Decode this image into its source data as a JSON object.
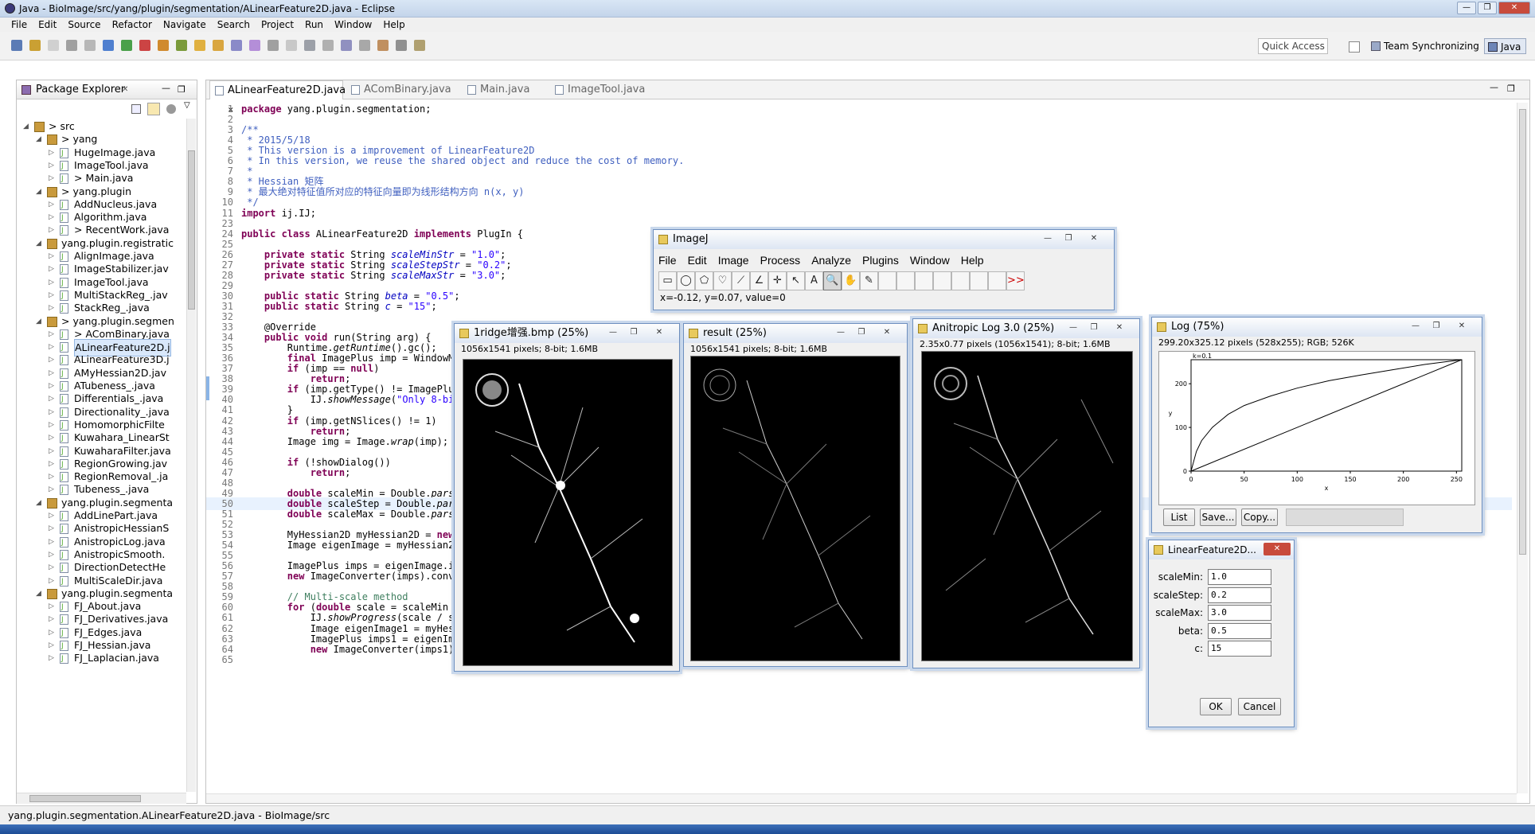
{
  "window": {
    "title": "Java - BioImage/src/yang/plugin/segmentation/ALinearFeature2D.java - Eclipse"
  },
  "menu": [
    "File",
    "Edit",
    "Source",
    "Refactor",
    "Navigate",
    "Search",
    "Project",
    "Run",
    "Window",
    "Help"
  ],
  "toolbar": {
    "quick_access": "Quick Access",
    "perspective_team": "Team Synchronizing",
    "perspective_java": "Java"
  },
  "package_explorer": {
    "title": "Package Explorer",
    "items": [
      {
        "depth": 1,
        "kind": "src",
        "label": "> src",
        "expanded": true
      },
      {
        "depth": 2,
        "kind": "pkg",
        "label": "> yang",
        "expanded": true
      },
      {
        "depth": 3,
        "kind": "file",
        "label": "HugeImage.java"
      },
      {
        "depth": 3,
        "kind": "file",
        "label": "ImageTool.java"
      },
      {
        "depth": 3,
        "kind": "file",
        "label": "> Main.java"
      },
      {
        "depth": 2,
        "kind": "pkg",
        "label": "> yang.plugin",
        "expanded": true
      },
      {
        "depth": 3,
        "kind": "file",
        "label": "AddNucleus.java"
      },
      {
        "depth": 3,
        "kind": "file",
        "label": "Algorithm.java"
      },
      {
        "depth": 3,
        "kind": "file",
        "label": "> RecentWork.java"
      },
      {
        "depth": 2,
        "kind": "pkg",
        "label": "yang.plugin.registratic",
        "expanded": true
      },
      {
        "depth": 3,
        "kind": "file",
        "label": "AlignImage.java"
      },
      {
        "depth": 3,
        "kind": "file",
        "label": "ImageStabilizer.jav"
      },
      {
        "depth": 3,
        "kind": "file",
        "label": "ImageTool.java"
      },
      {
        "depth": 3,
        "kind": "file",
        "label": "MultiStackReg_.jav"
      },
      {
        "depth": 3,
        "kind": "file",
        "label": "StackReg_.java"
      },
      {
        "depth": 2,
        "kind": "pkg",
        "label": "> yang.plugin.segmen",
        "expanded": true
      },
      {
        "depth": 3,
        "kind": "file",
        "label": "> AComBinary.java"
      },
      {
        "depth": 3,
        "kind": "file",
        "label": "ALinearFeature2D.j",
        "selected": true
      },
      {
        "depth": 3,
        "kind": "file",
        "label": "ALinearFeature3D.j"
      },
      {
        "depth": 3,
        "kind": "file",
        "label": "AMyHessian2D.jav"
      },
      {
        "depth": 3,
        "kind": "file",
        "label": "ATubeness_.java"
      },
      {
        "depth": 3,
        "kind": "file",
        "label": "Differentials_.java"
      },
      {
        "depth": 3,
        "kind": "file",
        "label": "Directionality_.java"
      },
      {
        "depth": 3,
        "kind": "file",
        "label": "HomomorphicFilte"
      },
      {
        "depth": 3,
        "kind": "file",
        "label": "Kuwahara_LinearSt"
      },
      {
        "depth": 3,
        "kind": "file",
        "label": "KuwaharaFilter.java"
      },
      {
        "depth": 3,
        "kind": "file",
        "label": "RegionGrowing.jav"
      },
      {
        "depth": 3,
        "kind": "file",
        "label": "RegionRemoval_.ja"
      },
      {
        "depth": 3,
        "kind": "file",
        "label": "Tubeness_.java"
      },
      {
        "depth": 2,
        "kind": "pkg",
        "label": "yang.plugin.segmenta",
        "expanded": true
      },
      {
        "depth": 3,
        "kind": "file",
        "label": "AddLinePart.java"
      },
      {
        "depth": 3,
        "kind": "file",
        "label": "AnistropicHessianS"
      },
      {
        "depth": 3,
        "kind": "file",
        "label": "AnistropicLog.java"
      },
      {
        "depth": 3,
        "kind": "file",
        "label": "AnistropicSmooth."
      },
      {
        "depth": 3,
        "kind": "file",
        "label": "DirectionDetectHe"
      },
      {
        "depth": 3,
        "kind": "file",
        "label": "MultiScaleDir.java"
      },
      {
        "depth": 2,
        "kind": "pkg",
        "label": "yang.plugin.segmenta",
        "expanded": true
      },
      {
        "depth": 3,
        "kind": "file",
        "label": "FJ_About.java"
      },
      {
        "depth": 3,
        "kind": "file",
        "label": "FJ_Derivatives.java"
      },
      {
        "depth": 3,
        "kind": "file",
        "label": "FJ_Edges.java"
      },
      {
        "depth": 3,
        "kind": "file",
        "label": "FJ_Hessian.java"
      },
      {
        "depth": 3,
        "kind": "file",
        "label": "FJ_Laplacian.java"
      }
    ]
  },
  "editor": {
    "tabs": [
      {
        "label": "ALinearFeature2D.java",
        "active": true
      },
      {
        "label": "AComBinary.java"
      },
      {
        "label": "Main.java"
      },
      {
        "label": "ImageTool.java"
      }
    ],
    "lines": [
      {
        "n": "1",
        "html": "<span class=\"kw\">package</span> yang.plugin.segmentation;"
      },
      {
        "n": "2",
        "html": ""
      },
      {
        "n": "3",
        "html": "<span class=\"cm\">/**</span>"
      },
      {
        "n": "4",
        "html": "<span class=\"cm\"> * 2015/5/18</span>"
      },
      {
        "n": "5",
        "html": "<span class=\"cm\"> * This version is a improvement of LinearFeature2D</span>"
      },
      {
        "n": "6",
        "html": "<span class=\"cm\"> * In this version, we reuse the shared object and reduce the cost of memory.</span>"
      },
      {
        "n": "7",
        "html": "<span class=\"cm\"> *</span>"
      },
      {
        "n": "8",
        "html": "<span class=\"cm\"> * Hessian 矩阵</span>"
      },
      {
        "n": "9",
        "html": "<span class=\"cm\"> * 最大绝对特征值所对应的特征向量即为线形结构方向 n(x, y)</span>"
      },
      {
        "n": "10",
        "html": "<span class=\"cm\"> */</span>"
      },
      {
        "n": "11",
        "html": "<span class=\"kw\">import</span> ij.IJ;"
      },
      {
        "n": "23",
        "html": ""
      },
      {
        "n": "24",
        "html": "<span class=\"kw\">public class</span> ALinearFeature2D <span class=\"kw\">implements</span> PlugIn {"
      },
      {
        "n": "25",
        "html": ""
      },
      {
        "n": "26",
        "html": "    <span class=\"kw\">private static</span> String <span class=\"fld\">scaleMinStr</span> = <span class=\"str\">\"1.0\"</span>;"
      },
      {
        "n": "27",
        "html": "    <span class=\"kw\">private static</span> String <span class=\"fld\">scaleStepStr</span> = <span class=\"str\">\"0.2\"</span>;"
      },
      {
        "n": "28",
        "html": "    <span class=\"kw\">private static</span> String <span class=\"fld\">scaleMaxStr</span> = <span class=\"str\">\"3.0\"</span>;"
      },
      {
        "n": "29",
        "html": ""
      },
      {
        "n": "30",
        "html": "    <span class=\"kw\">public static</span> String <span class=\"fld\">beta</span> = <span class=\"str\">\"0.5\"</span>;"
      },
      {
        "n": "31",
        "html": "    <span class=\"kw\">public static</span> String <span class=\"fld\">c</span> = <span class=\"str\">\"15\"</span>;"
      },
      {
        "n": "32",
        "html": ""
      },
      {
        "n": "33",
        "html": "    @Override"
      },
      {
        "n": "34",
        "html": "    <span class=\"kw\">public void</span> run(String arg) {"
      },
      {
        "n": "35",
        "html": "        Runtime.<i>getRuntime</i>().gc();"
      },
      {
        "n": "36",
        "html": "        <span class=\"kw\">final</span> ImagePlus imp = WindowMa"
      },
      {
        "n": "37",
        "html": "        <span class=\"kw\">if</span> (imp == <span class=\"kw\">null</span>)"
      },
      {
        "n": "38",
        "html": "            <span class=\"kw\">return</span>;"
      },
      {
        "n": "39",
        "html": "        <span class=\"kw\">if</span> (imp.getType() != ImagePlus"
      },
      {
        "n": "40",
        "html": "            IJ.<i>showMessage</i>(<span class=\"str\">\"Only 8-bit</span>"
      },
      {
        "n": "41",
        "html": "        }"
      },
      {
        "n": "42",
        "html": "        <span class=\"kw\">if</span> (imp.getNSlices() != 1)"
      },
      {
        "n": "43",
        "html": "            <span class=\"kw\">return</span>;"
      },
      {
        "n": "44",
        "html": "        Image img = Image.<i>wrap</i>(imp);"
      },
      {
        "n": "45",
        "html": ""
      },
      {
        "n": "46",
        "html": "        <span class=\"kw\">if</span> (!showDialog())"
      },
      {
        "n": "47",
        "html": "            <span class=\"kw\">return</span>;"
      },
      {
        "n": "48",
        "html": ""
      },
      {
        "n": "49",
        "html": "        <span class=\"kw\">double</span> scaleMin = Double.<i>parse</i>"
      },
      {
        "n": "50",
        "html": "        <span class=\"kw\">double</span> scaleStep = Double.<i>pars</i>",
        "hl": true
      },
      {
        "n": "51",
        "html": "        <span class=\"kw\">double</span> scaleMax = Double.<i>parse</i>"
      },
      {
        "n": "52",
        "html": ""
      },
      {
        "n": "53",
        "html": "        MyHessian2D myHessian2D = <span class=\"kw\">new</span>"
      },
      {
        "n": "54",
        "html": "        Image eigenImage = myHessian2D"
      },
      {
        "n": "55",
        "html": ""
      },
      {
        "n": "56",
        "html": "        ImagePlus imps = eigenImage.im"
      },
      {
        "n": "57",
        "html": "        <span class=\"kw\">new</span> ImageConverter(imps).convertToGray8();"
      },
      {
        "n": "58",
        "html": ""
      },
      {
        "n": "59",
        "html": "        <span style=\"color:#3f7f5f\">// Multi-scale method</span>"
      },
      {
        "n": "60",
        "html": "        <span class=\"kw\">for</span> (<span class=\"kw\">double</span> scale = scaleMin + scaleStep; scale &lt;= scaleMax; scale += scaleStep) {"
      },
      {
        "n": "61",
        "html": "            IJ.<i>showProgress</i>(scale / scaleMax);"
      },
      {
        "n": "62",
        "html": "            Image eigenImage1 = myHessian2D.run(img, scale);"
      },
      {
        "n": "63",
        "html": "            ImagePlus imps1 = eigenImage1.imageplus(); <span style=\"color:#3f7f5f\">// share</span>"
      },
      {
        "n": "64",
        "html": "            <span class=\"kw\">new</span> ImageConverter(imps1).convertToGray8();"
      },
      {
        "n": "65",
        "html": ""
      }
    ]
  },
  "status": {
    "text": "yang.plugin.segmentation.ALinearFeature2D.java - BioImage/src"
  },
  "imagej": {
    "title": "ImageJ",
    "menu": [
      "File",
      "Edit",
      "Image",
      "Process",
      "Analyze",
      "Plugins",
      "Window",
      "Help"
    ],
    "tools": [
      "▭",
      "◯",
      "⬠",
      "♡",
      "⟋",
      "∠",
      "✛",
      "↖",
      "A",
      "🔍",
      "✋",
      "✎",
      "",
      "",
      "",
      "",
      "",
      "",
      "",
      ">>"
    ],
    "status": "x=-0.12, y=0.07, value=0"
  },
  "img1": {
    "title": "1ridge增强.bmp (25%)",
    "info": "1056x1541 pixels; 8-bit; 1.6MB"
  },
  "img2": {
    "title": "result (25%)",
    "info": "1056x1541 pixels; 8-bit; 1.6MB"
  },
  "img3": {
    "title": "Anitropic Log 3.0 (25%)",
    "info": "2.35x0.77 pixels (1056x1541); 8-bit; 1.6MB"
  },
  "logwin": {
    "title": "Log (75%)",
    "info": "299.20x325.12 pixels (528x255); RGB; 526K",
    "buttons": {
      "list": "List",
      "save": "Save...",
      "copy": "Copy..."
    },
    "chart_data": {
      "type": "line",
      "annotation": "k=0.1",
      "xlabel": "x",
      "ylabel": "y",
      "xlim": [
        0,
        255
      ],
      "ylim": [
        0,
        255
      ],
      "xticks": [
        "0",
        "50",
        "100",
        "150",
        "200",
        "250"
      ],
      "yticks": [
        "0",
        "100",
        "200"
      ],
      "series": [
        {
          "x": [
            0,
            255
          ],
          "y": [
            0,
            255
          ]
        },
        {
          "x": [
            0,
            5,
            10,
            20,
            35,
            50,
            75,
            100,
            130,
            160,
            190,
            220,
            255
          ],
          "y": [
            0,
            45,
            70,
            100,
            130,
            150,
            172,
            190,
            207,
            220,
            232,
            244,
            255
          ]
        }
      ]
    }
  },
  "dialog": {
    "title": "LinearFeature2D...",
    "fields": [
      {
        "label": "scaleMin:",
        "value": "1.0"
      },
      {
        "label": "scaleStep:",
        "value": "0.2"
      },
      {
        "label": "scaleMax:",
        "value": "3.0"
      },
      {
        "label": "beta:",
        "value": "0.5"
      },
      {
        "label": "c:",
        "value": "15"
      }
    ],
    "ok": "OK",
    "cancel": "Cancel"
  }
}
